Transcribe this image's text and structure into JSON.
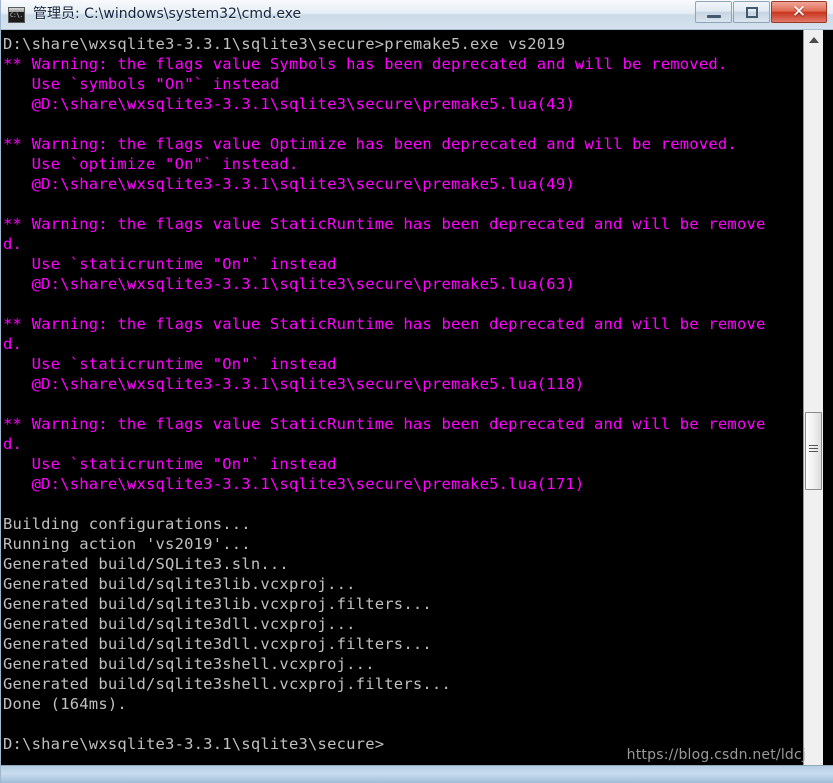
{
  "window": {
    "title": "管理员: C:\\windows\\system32\\cmd.exe",
    "icon_name": "cmd-console-icon",
    "icon_label": "C:\\.",
    "controls": {
      "minimize_label": "Minimize",
      "maximize_label": "Maximize",
      "close_label": "✕"
    }
  },
  "console": {
    "colors": {
      "background": "#000000",
      "foreground": "#c0c0c0",
      "warning": "#ff00ff"
    },
    "lines": [
      {
        "text": "D:\\share\\wxsqlite3-3.3.1\\sqlite3\\secure>premake5.exe vs2019",
        "color": "white"
      },
      {
        "text": "** Warning: the flags value Symbols has been deprecated and will be removed.",
        "color": "magenta"
      },
      {
        "text": "   Use `symbols \"On\"` instead",
        "color": "magenta"
      },
      {
        "text": "   @D:\\share\\wxsqlite3-3.3.1\\sqlite3\\secure\\premake5.lua(43)",
        "color": "magenta"
      },
      {
        "text": "",
        "color": "magenta"
      },
      {
        "text": "** Warning: the flags value Optimize has been deprecated and will be removed.",
        "color": "magenta"
      },
      {
        "text": "   Use `optimize \"On\"` instead.",
        "color": "magenta"
      },
      {
        "text": "   @D:\\share\\wxsqlite3-3.3.1\\sqlite3\\secure\\premake5.lua(49)",
        "color": "magenta"
      },
      {
        "text": "",
        "color": "magenta"
      },
      {
        "text": "** Warning: the flags value StaticRuntime has been deprecated and will be remove",
        "color": "magenta"
      },
      {
        "text": "d.",
        "color": "magenta"
      },
      {
        "text": "   Use `staticruntime \"On\"` instead",
        "color": "magenta"
      },
      {
        "text": "   @D:\\share\\wxsqlite3-3.3.1\\sqlite3\\secure\\premake5.lua(63)",
        "color": "magenta"
      },
      {
        "text": "",
        "color": "magenta"
      },
      {
        "text": "** Warning: the flags value StaticRuntime has been deprecated and will be remove",
        "color": "magenta"
      },
      {
        "text": "d.",
        "color": "magenta"
      },
      {
        "text": "   Use `staticruntime \"On\"` instead",
        "color": "magenta"
      },
      {
        "text": "   @D:\\share\\wxsqlite3-3.3.1\\sqlite3\\secure\\premake5.lua(118)",
        "color": "magenta"
      },
      {
        "text": "",
        "color": "magenta"
      },
      {
        "text": "** Warning: the flags value StaticRuntime has been deprecated and will be remove",
        "color": "magenta"
      },
      {
        "text": "d.",
        "color": "magenta"
      },
      {
        "text": "   Use `staticruntime \"On\"` instead",
        "color": "magenta"
      },
      {
        "text": "   @D:\\share\\wxsqlite3-3.3.1\\sqlite3\\secure\\premake5.lua(171)",
        "color": "magenta"
      },
      {
        "text": "",
        "color": "white"
      },
      {
        "text": "Building configurations...",
        "color": "white"
      },
      {
        "text": "Running action 'vs2019'...",
        "color": "white"
      },
      {
        "text": "Generated build/SQLite3.sln...",
        "color": "white"
      },
      {
        "text": "Generated build/sqlite3lib.vcxproj...",
        "color": "white"
      },
      {
        "text": "Generated build/sqlite3lib.vcxproj.filters...",
        "color": "white"
      },
      {
        "text": "Generated build/sqlite3dll.vcxproj...",
        "color": "white"
      },
      {
        "text": "Generated build/sqlite3dll.vcxproj.filters...",
        "color": "white"
      },
      {
        "text": "Generated build/sqlite3shell.vcxproj...",
        "color": "white"
      },
      {
        "text": "Generated build/sqlite3shell.vcxproj.filters...",
        "color": "white"
      },
      {
        "text": "Done (164ms).",
        "color": "white"
      },
      {
        "text": "",
        "color": "white"
      },
      {
        "text": "D:\\share\\wxsqlite3-3.3.1\\sqlite3\\secure>",
        "color": "white"
      }
    ]
  },
  "scrollbar": {
    "up_arrow_name": "scroll-up-arrow",
    "thumb_name": "scroll-thumb"
  },
  "watermark": {
    "text": "https://blog.csdn.net/ldcj"
  }
}
